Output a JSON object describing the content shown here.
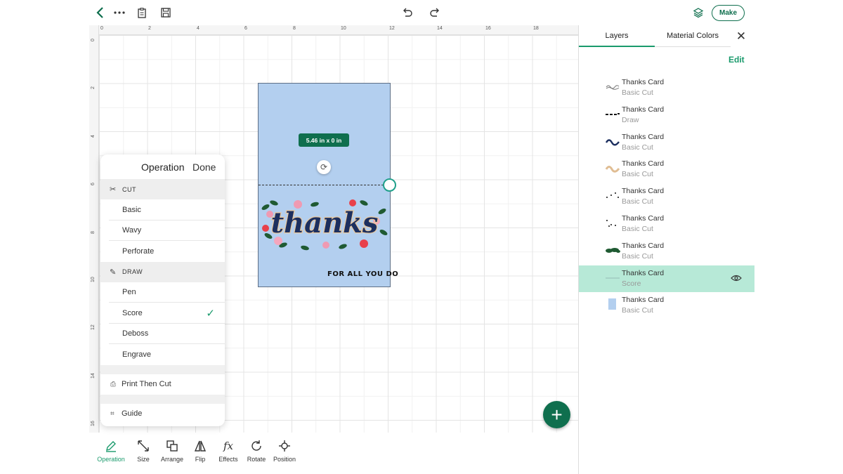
{
  "toolbar": {
    "make_label": "Make"
  },
  "ruler": {
    "top_ticks": [
      "0",
      "2",
      "4",
      "6",
      "8",
      "10",
      "12",
      "14",
      "16",
      "18"
    ],
    "left_ticks": [
      "0",
      "2",
      "4",
      "6",
      "8",
      "10",
      "12",
      "14",
      "16"
    ]
  },
  "canvas": {
    "dimension_badge": "5.46 in x 0 in",
    "card_caption": "FOR ALL YOU DO",
    "card_art_text": "thanks"
  },
  "operation_panel": {
    "title": "Operation",
    "done_label": "Done",
    "sections": [
      {
        "label": "CUT",
        "items": [
          "Basic",
          "Wavy",
          "Perforate"
        ]
      },
      {
        "label": "DRAW",
        "items": [
          "Pen",
          "Score",
          "Deboss",
          "Engrave"
        ]
      }
    ],
    "selected_item": "Score",
    "print_then_cut_label": "Print Then Cut",
    "guide_label": "Guide"
  },
  "bottom_toolbar": [
    {
      "label": "Operation",
      "icon": "pen-icon",
      "active": true
    },
    {
      "label": "Size",
      "icon": "resize-icon",
      "active": false
    },
    {
      "label": "Arrange",
      "icon": "arrange-icon",
      "active": false
    },
    {
      "label": "Flip",
      "icon": "flip-icon",
      "active": false
    },
    {
      "label": "Effects",
      "icon": "fx-icon",
      "active": false
    },
    {
      "label": "Rotate",
      "icon": "rotate-icon",
      "active": false
    },
    {
      "label": "Position",
      "icon": "position-icon",
      "active": false
    }
  ],
  "layers_panel": {
    "tab_layers": "Layers",
    "tab_colors": "Material Colors",
    "edit_label": "Edit",
    "layers": [
      {
        "name": "Thanks Card",
        "type": "Basic Cut",
        "thumb": "outline-word"
      },
      {
        "name": "Thanks Card",
        "type": "Draw",
        "thumb": "dashes"
      },
      {
        "name": "Thanks Card",
        "type": "Basic Cut",
        "thumb": "navy-word"
      },
      {
        "name": "Thanks Card",
        "type": "Basic Cut",
        "thumb": "tan-word"
      },
      {
        "name": "Thanks Card",
        "type": "Basic Cut",
        "thumb": "dots"
      },
      {
        "name": "Thanks Card",
        "type": "Basic Cut",
        "thumb": "dots2"
      },
      {
        "name": "Thanks Card",
        "type": "Basic Cut",
        "thumb": "green-leaves"
      },
      {
        "name": "Thanks Card",
        "type": "Score",
        "thumb": "line",
        "selected": true
      },
      {
        "name": "Thanks Card",
        "type": "Basic Cut",
        "thumb": "blue-rect"
      }
    ]
  },
  "colors": {
    "accent": "#0f6f4e",
    "accent_light": "#1a9a6c",
    "card": "#b3cfef",
    "selected_layer": "#b7e9d7"
  }
}
